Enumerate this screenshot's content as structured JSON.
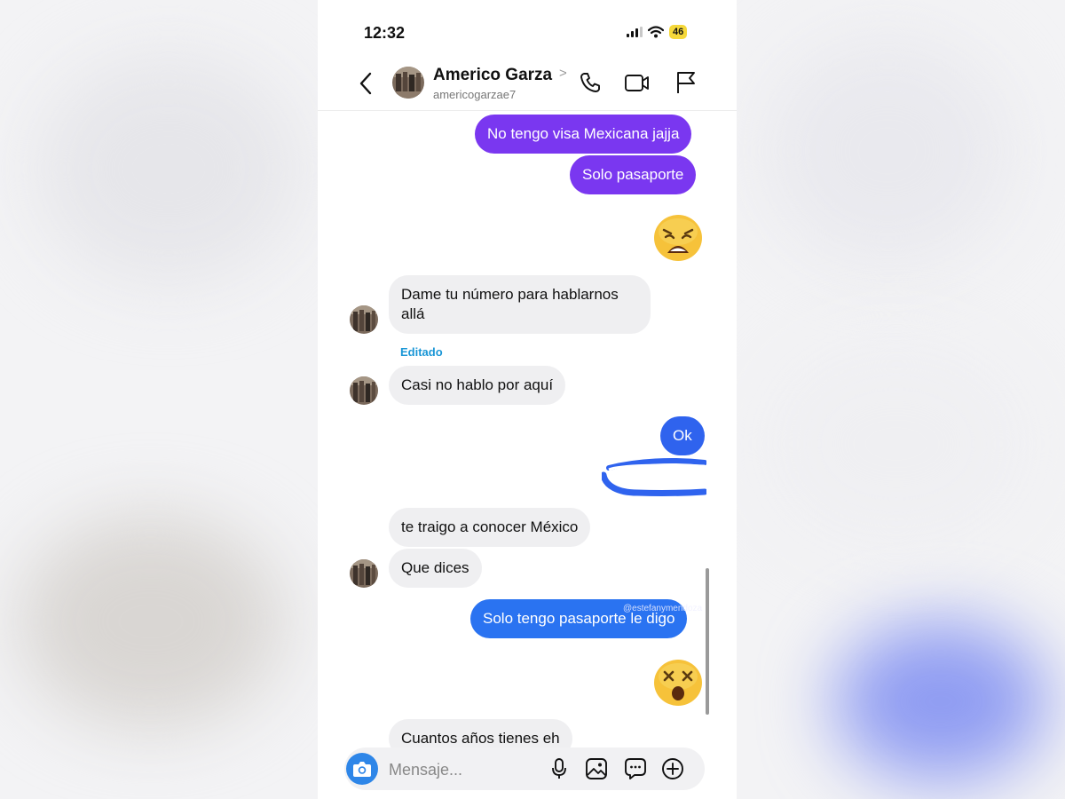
{
  "status_bar": {
    "time": "12:32",
    "battery": "46"
  },
  "header": {
    "name": "Americo Garza",
    "username": "americogarzae7",
    "chevron": ">"
  },
  "messages": [
    {
      "side": "out",
      "text": "No tengo visa Mexicana jajja"
    },
    {
      "side": "out",
      "text": "Solo pasaporte"
    },
    {
      "side": "out",
      "emoji": "weary-face"
    },
    {
      "side": "in",
      "text_line1": "Dame tu número para hablarnos",
      "text_line2": "allá"
    },
    {
      "side": "in",
      "label": "Editado",
      "text": "Casi no hablo por aquí"
    },
    {
      "side": "out",
      "text": "Ok"
    },
    {
      "side": "out",
      "redacted": true
    },
    {
      "side": "in",
      "text": "te traigo a conocer México"
    },
    {
      "side": "in",
      "text": "Que dices"
    },
    {
      "side": "out",
      "text": "Solo tengo pasaporte le digo"
    },
    {
      "side": "out",
      "emoji": "dizzy-face"
    },
    {
      "side": "in",
      "text": "Cuantos años tienes eh"
    }
  ],
  "watermark": "@estefanymendoza",
  "composer": {
    "placeholder": "Mensaje..."
  },
  "colors": {
    "outgoing_purple": "#7a37f0",
    "outgoing_blue": "#2f63ee",
    "incoming_bg": "#efeff1",
    "edited_label": "#1a96d6",
    "camera_button": "#2e86e8"
  }
}
